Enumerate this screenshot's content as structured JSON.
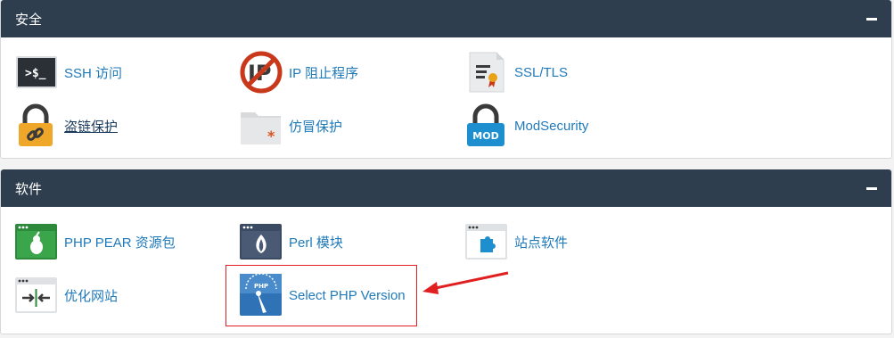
{
  "colors": {
    "header_bg": "#2f3e4e",
    "link": "#1f7ab9",
    "annotation_red": "#e02020"
  },
  "sections": {
    "security": {
      "title": "安全",
      "items": [
        {
          "label": "SSH 访问",
          "icon": "terminal-icon"
        },
        {
          "label": "IP 阻止程序",
          "icon": "ip-block-icon"
        },
        {
          "label": "SSL/TLS",
          "icon": "certificate-icon"
        },
        {
          "label": "盗链保护",
          "icon": "padlock-link-icon"
        },
        {
          "label": "仿冒保护",
          "icon": "folder-asterisk-icon"
        },
        {
          "label": "ModSecurity",
          "icon": "mod-lock-icon"
        }
      ]
    },
    "software": {
      "title": "软件",
      "items": [
        {
          "label": "PHP PEAR 资源包",
          "icon": "pear-window-icon"
        },
        {
          "label": "Perl 模块",
          "icon": "onion-window-icon"
        },
        {
          "label": "站点软件",
          "icon": "puzzle-window-icon"
        },
        {
          "label": "优化网站",
          "icon": "compress-window-icon"
        },
        {
          "label": "Select PHP Version",
          "icon": "php-gauge-icon"
        }
      ]
    }
  }
}
